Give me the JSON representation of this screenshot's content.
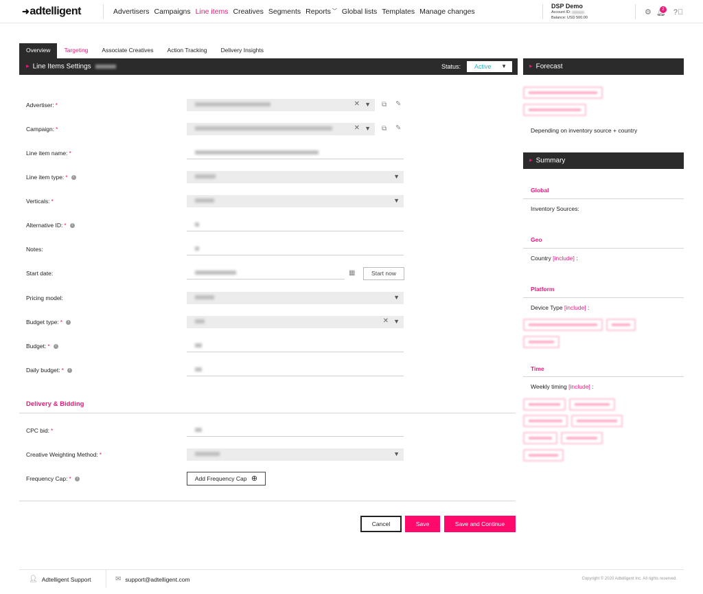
{
  "header": {
    "logo": "adtelligent",
    "nav": [
      {
        "label": "Advertisers",
        "active": false
      },
      {
        "label": "Campaigns",
        "active": false
      },
      {
        "label": "Line items",
        "active": true
      },
      {
        "label": "Creatives",
        "active": false
      },
      {
        "label": "Segments",
        "active": false
      },
      {
        "label": "Reports",
        "active": false,
        "dropdown": true
      },
      {
        "label": "Global lists",
        "active": false
      },
      {
        "label": "Templates",
        "active": false
      },
      {
        "label": "Manage changes",
        "active": false
      }
    ],
    "account": {
      "name": "DSP Demo",
      "id_label": "Account ID:",
      "balance": "Balance: USD 500.00"
    },
    "notifications_count": "2"
  },
  "tabs": [
    {
      "label": "Overview",
      "state": "active"
    },
    {
      "label": "Targeting",
      "state": "pink"
    },
    {
      "label": "Associate Creatives",
      "state": ""
    },
    {
      "label": "Action Tracking",
      "state": ""
    },
    {
      "label": "Delivery Insights",
      "state": ""
    }
  ],
  "settings": {
    "title": "Line Items Settings",
    "status_label": "Status:",
    "status_value": "Active"
  },
  "form": {
    "advertiser": "Advertiser:",
    "campaign": "Campaign:",
    "line_item_name": "Line item name:",
    "line_item_type": "Line item type:",
    "verticals": "Verticals:",
    "alternative_id": "Alternative ID:",
    "notes": "Notes:",
    "start_date": "Start date:",
    "start_now": "Start now",
    "pricing_model": "Pricing model:",
    "budget_type": "Budget type:",
    "budget": "Budget:",
    "daily_budget": "Daily budget:",
    "delivery_title": "Delivery & Bidding",
    "cpc_bid": "CPC bid:",
    "creative_weighting": "Creative Weighting Method:",
    "frequency_cap": "Frequency Cap:",
    "add_frequency_cap": "Add Frequency Cap"
  },
  "actions": {
    "cancel": "Cancel",
    "save": "Save",
    "save_continue": "Save and Continue"
  },
  "forecast": {
    "title": "Forecast",
    "note": "Depending on inventory source + country"
  },
  "summary": {
    "title": "Summary",
    "global": "Global",
    "inventory_sources": "Inventory Sources:",
    "geo": "Geo",
    "country": "Country",
    "platform": "Platform",
    "device_type": "Device Type",
    "time": "Time",
    "weekly_timing": "Weekly timing",
    "include": "[include]",
    "colon": ":"
  },
  "footer": {
    "support": "Adtelligent Support",
    "email": "support@adtelligent.com",
    "copyright": "Copyright © 2020 Adtelligent Inc. All rights reserved."
  },
  "colors": {
    "accent": "#e8197a",
    "button": "#ff0a6c",
    "dark": "#2b2b2b",
    "status": "#2bb3c0"
  }
}
